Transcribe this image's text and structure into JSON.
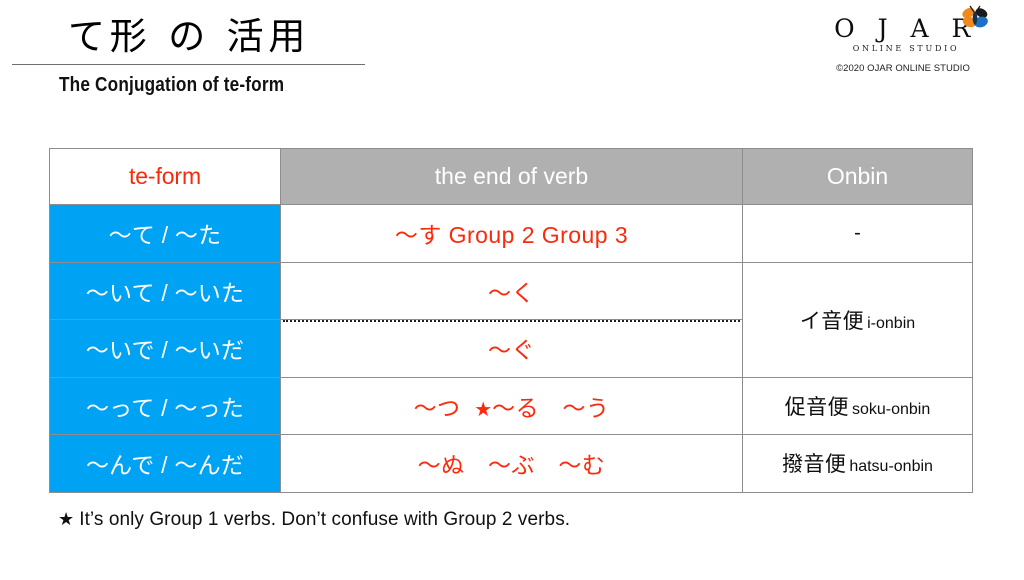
{
  "slide": {
    "title_ja": "て形 の 活用",
    "subtitle_en": "The Conjugation of te-form"
  },
  "logo": {
    "wordmark": "O J A R",
    "tagline": "ONLINE STUDIO",
    "copyright": "©2020 OJAR ONLINE STUDIO",
    "icon_name": "butterfly-icon",
    "colors": {
      "wing_orange": "#f08a1e",
      "wing_blue": "#1f6fc4",
      "body_dark": "#1a1a1a"
    }
  },
  "table": {
    "columns": [
      {
        "key": "te_form",
        "label": "te-form"
      },
      {
        "key": "end_of_verb",
        "label": "the end of verb"
      },
      {
        "key": "onbin",
        "label": "Onbin"
      }
    ],
    "rows": [
      {
        "te_form": "〜て / 〜た",
        "end_of_verb": "〜す Group 2 Group 3",
        "onbin_kanji": "-",
        "onbin_romaji": ""
      },
      {
        "te_form": "〜いて / 〜いた",
        "end_of_verb": "〜く",
        "onbin_kanji": "イ音便",
        "onbin_romaji": "i-onbin"
      },
      {
        "te_form": "〜いで / 〜いだ",
        "end_of_verb": "〜ぐ",
        "onbin_kanji": "",
        "onbin_romaji": ""
      },
      {
        "te_form": "〜って / 〜った",
        "end_of_verb_pre": "〜つ",
        "end_of_verb_star": "★",
        "end_of_verb_post": "〜る　〜う",
        "onbin_kanji": "促音便",
        "onbin_romaji": "soku-onbin"
      },
      {
        "te_form": "〜んで / 〜んだ",
        "end_of_verb": "〜ぬ　〜ぶ　〜む",
        "onbin_kanji": "撥音便",
        "onbin_romaji": "hatsu-onbin"
      }
    ]
  },
  "footnote": {
    "star": "★",
    "text": "It’s only Group 1 verbs. Don’t confuse with Group 2 verbs."
  },
  "colors": {
    "accent_blue": "#00a2f3",
    "accent_red": "#fb2a0c",
    "header_grey": "#b0b0b0",
    "background": "#ffffff"
  }
}
